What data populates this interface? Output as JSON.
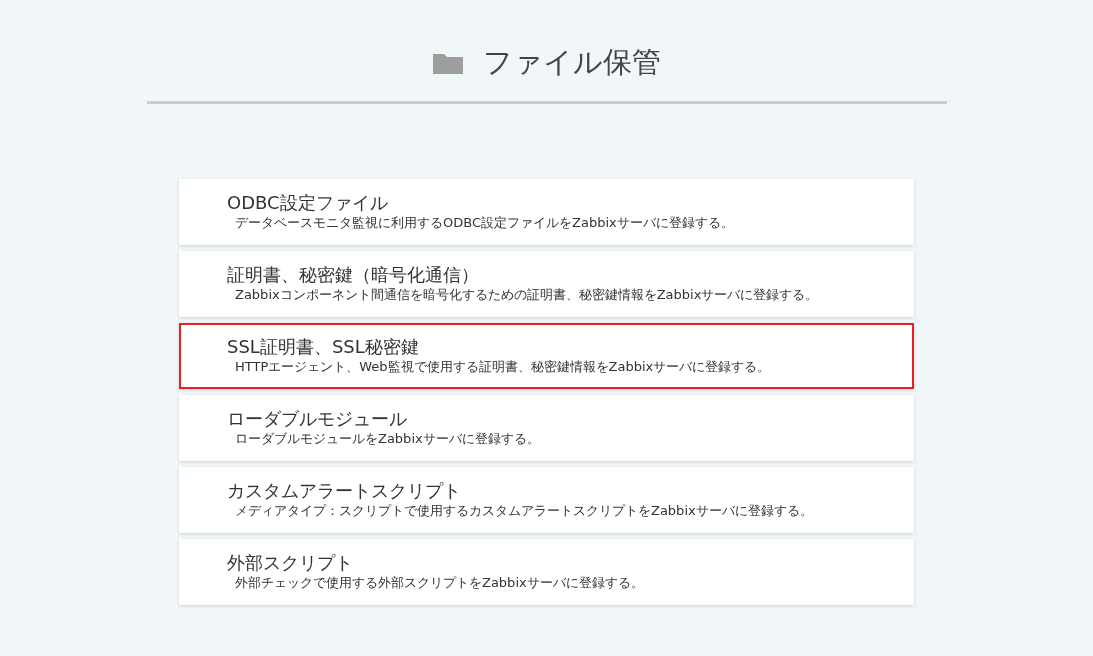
{
  "header": {
    "title": "ファイル保管"
  },
  "items": [
    {
      "title": "ODBC設定ファイル",
      "description": "データベースモニタ監視に利用するODBC設定ファイルをZabbixサーバに登録する。",
      "selected": false
    },
    {
      "title": "証明書、秘密鍵（暗号化通信）",
      "description": "Zabbixコンポーネント間通信を暗号化するための証明書、秘密鍵情報をZabbixサーバに登録する。",
      "selected": false
    },
    {
      "title": "SSL証明書、SSL秘密鍵",
      "description": "HTTPエージェント、Web監視で使用する証明書、秘密鍵情報をZabbixサーバに登録する。",
      "selected": true
    },
    {
      "title": "ローダブルモジュール",
      "description": "ローダブルモジュールをZabbixサーバに登録する。",
      "selected": false
    },
    {
      "title": "カスタムアラートスクリプト",
      "description": "メディアタイプ：スクリプトで使用するカスタムアラートスクリプトをZabbixサーバに登録する。",
      "selected": false
    },
    {
      "title": "外部スクリプト",
      "description": "外部チェックで使用する外部スクリプトをZabbixサーバに登録する。",
      "selected": false
    }
  ]
}
